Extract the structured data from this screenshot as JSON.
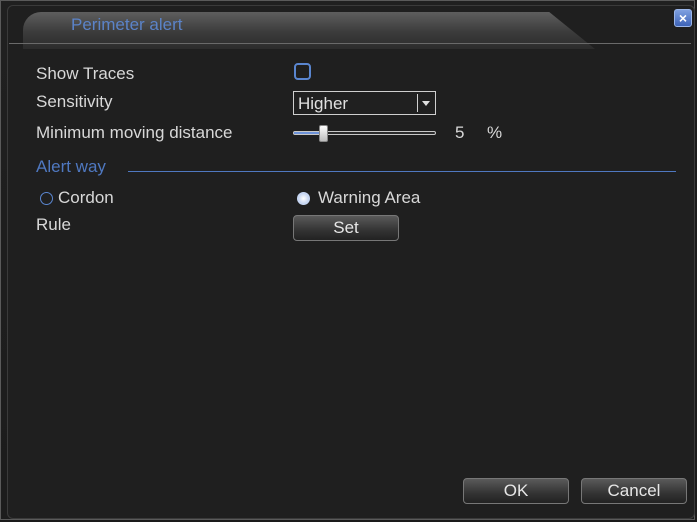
{
  "window": {
    "title": "Perimeter alert",
    "close_glyph": "×"
  },
  "form": {
    "show_traces": {
      "label": "Show Traces",
      "checked": false
    },
    "sensitivity": {
      "label": "Sensitivity",
      "value": "Higher"
    },
    "min_distance": {
      "label": "Minimum moving distance",
      "value": "5",
      "unit": "%",
      "level_percent": 5
    },
    "alert_way": {
      "label": "Alert way",
      "options": [
        {
          "label": "Cordon",
          "selected": false
        },
        {
          "label": "Warning Area",
          "selected": true
        }
      ]
    },
    "rule": {
      "label": "Rule",
      "button": "Set"
    }
  },
  "footer": {
    "ok": "OK",
    "cancel": "Cancel"
  },
  "colors": {
    "accent": "#5a86d0",
    "section": "#4f78c0",
    "text": "#d8d8d8"
  },
  "icons": {
    "close": "close-icon",
    "dropdown": "chevron-down-icon"
  }
}
